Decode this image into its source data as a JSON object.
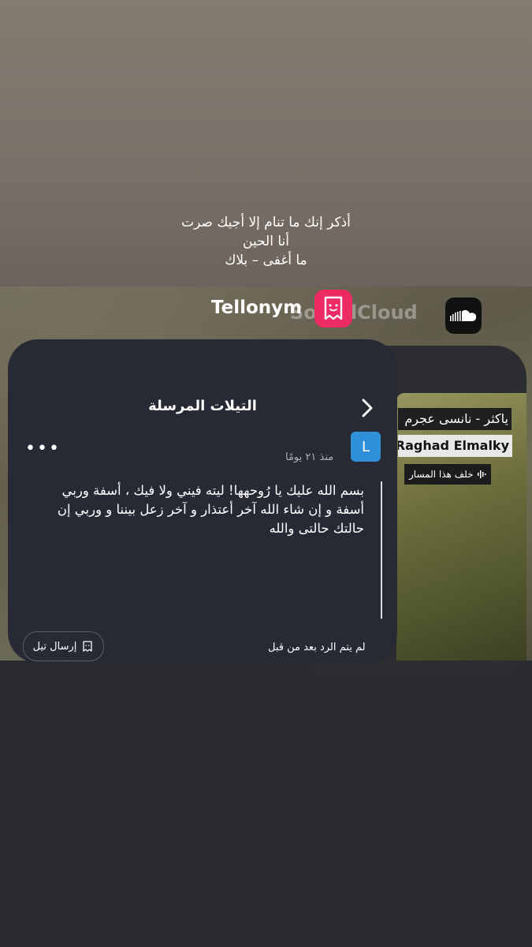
{
  "caption": {
    "line1": "أذكر إنك ما تنام إلا أجيك صرت",
    "line2": "أنا الحين",
    "line3": "ما أغفى – بلاك"
  },
  "apps": {
    "tellonym_label": "Tellonym",
    "soundcloud_label": "SoundCloud"
  },
  "soundcloud": {
    "track_title": "ياكثر - نانسى عجرم",
    "artist": "Raghad Elmalky",
    "behind_label": "خلف هذا المسار"
  },
  "tellonym": {
    "header_title": "التيلات المرسلة",
    "avatar_letter": "L",
    "time": "منذ ٢١ يومًا",
    "message": "بسم الله عليك يا رُوحهها! ليته فيني ولا فيك ، أسفة وربي أسفة و إن شاء الله آخر أعتذار و آخر زعل بيننا و وربي إن حالتك حالتى والله",
    "no_reply": "لم يتم الرد بعد من قبل",
    "send_button": "إرسال تيل"
  },
  "colors": {
    "tellonym_brand": "#ec2a63",
    "avatar_blue": "#2f8fd8",
    "card_bg": "#272a34"
  }
}
